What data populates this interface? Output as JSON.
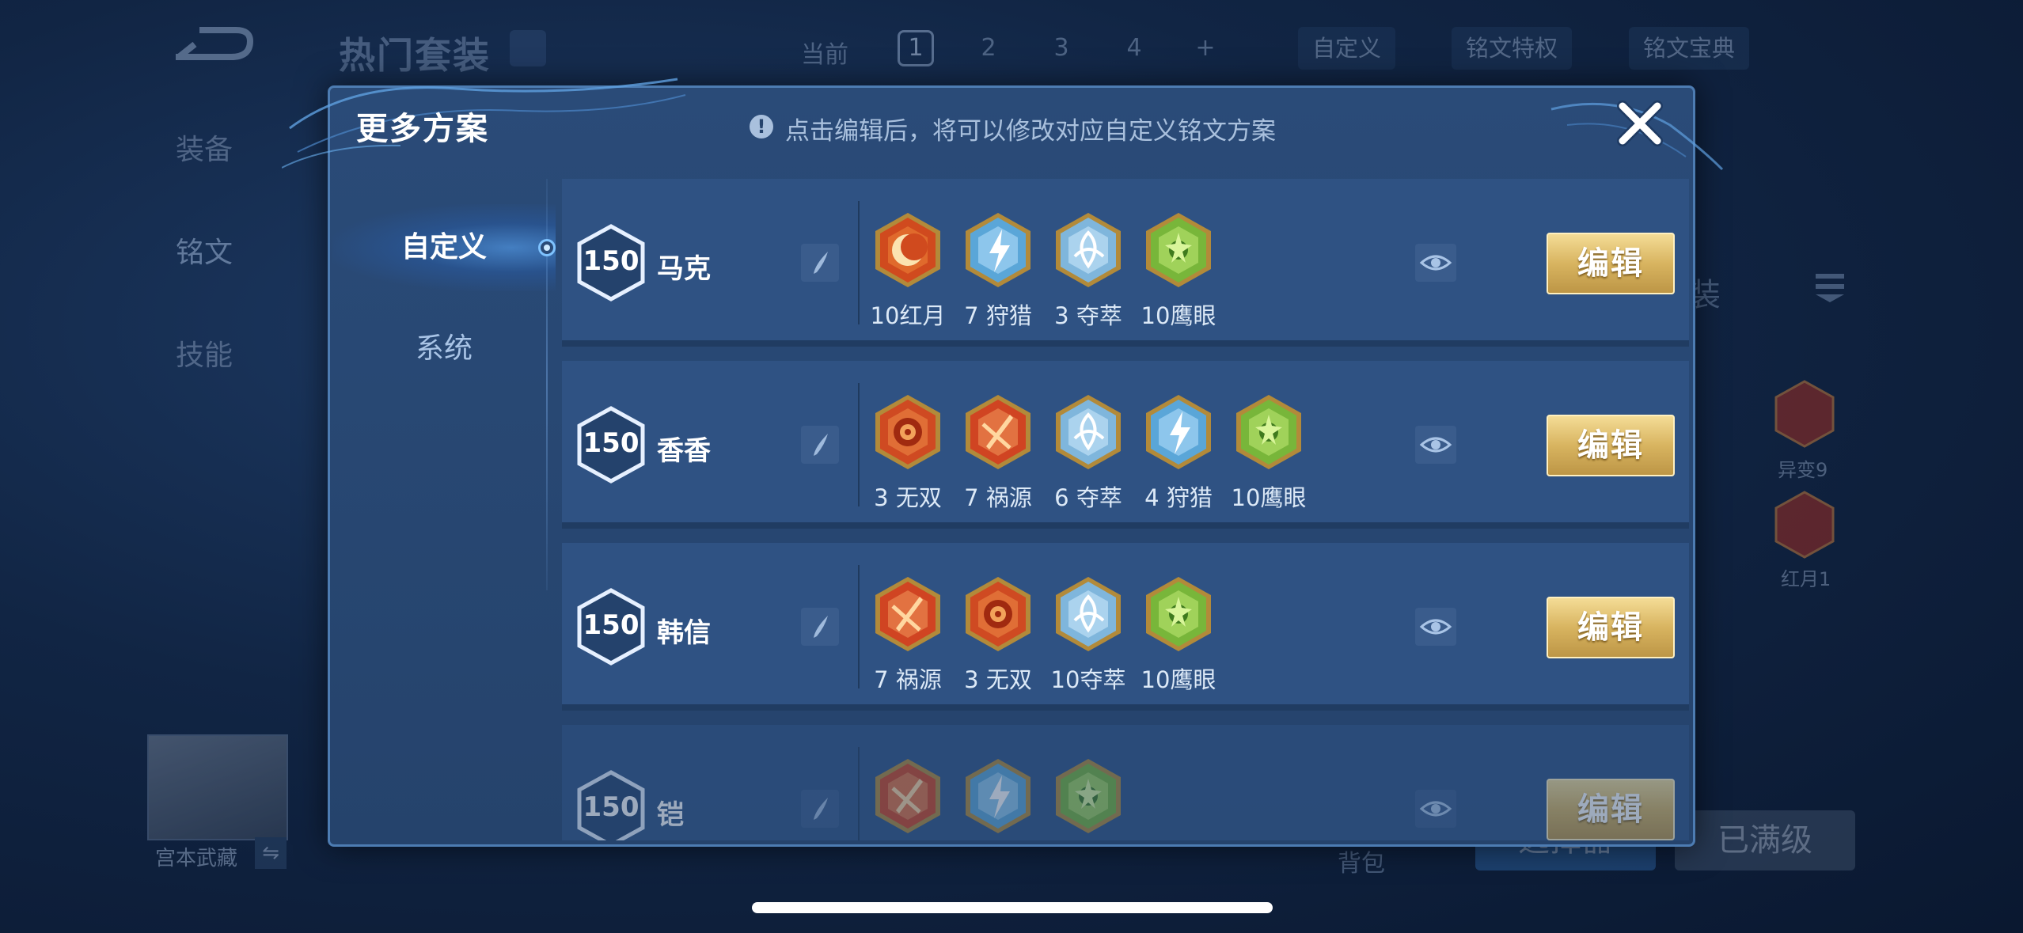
{
  "background": {
    "title": "热门套装",
    "current_label": "当前",
    "pages": [
      "1",
      "2",
      "3",
      "4",
      "+"
    ],
    "custom_label": "自定义",
    "rune_privilege": "铭文特权",
    "rune_codex": "铭文宝典",
    "left_menu": [
      "装备",
      "铭文",
      "技能"
    ],
    "hero_name": "宫本武藏",
    "swap_icon": "⇋",
    "bag_label": "背包",
    "select_label": "选择器",
    "maxed_label": "已满级",
    "side_label": "装",
    "right_runes": [
      {
        "label": "异变9",
        "color": "#c0392b"
      },
      {
        "label": "红月1",
        "color": "#c0392b"
      }
    ]
  },
  "modal": {
    "title": "更多方案",
    "hint_icon": "!",
    "hint": "点击编辑后，将可以修改对应自定义铭文方案",
    "tabs": [
      {
        "label": "自定义",
        "selected": true
      },
      {
        "label": "系统",
        "selected": false
      }
    ],
    "edit_label": "编辑",
    "rows": [
      {
        "level": "150",
        "name": "马克",
        "runes": [
          {
            "label": "10红月",
            "type": "red-moon"
          },
          {
            "label": "7 狩猎",
            "type": "hunt"
          },
          {
            "label": "3 夺萃",
            "type": "seize"
          },
          {
            "label": "10鹰眼",
            "type": "hawkeye"
          }
        ]
      },
      {
        "level": "150",
        "name": "香香",
        "runes": [
          {
            "label": "3 无双",
            "type": "peerless"
          },
          {
            "label": "7 祸源",
            "type": "calamity"
          },
          {
            "label": "6 夺萃",
            "type": "seize"
          },
          {
            "label": "4 狩猎",
            "type": "hunt"
          },
          {
            "label": "10鹰眼",
            "type": "hawkeye"
          }
        ]
      },
      {
        "level": "150",
        "name": "韩信",
        "runes": [
          {
            "label": "7 祸源",
            "type": "calamity"
          },
          {
            "label": "3 无双",
            "type": "peerless"
          },
          {
            "label": "10夺萃",
            "type": "seize"
          },
          {
            "label": "10鹰眼",
            "type": "hawkeye"
          }
        ]
      },
      {
        "level": "150",
        "name": "铠",
        "runes": [
          {
            "label": "",
            "type": "calamity"
          },
          {
            "label": "",
            "type": "hunt"
          },
          {
            "label": "",
            "type": "hawkeye"
          }
        ]
      }
    ]
  },
  "icons": {
    "close": "close-icon",
    "rename": "pen-icon",
    "preview": "eye-icon",
    "hint": "exclamation-icon"
  }
}
